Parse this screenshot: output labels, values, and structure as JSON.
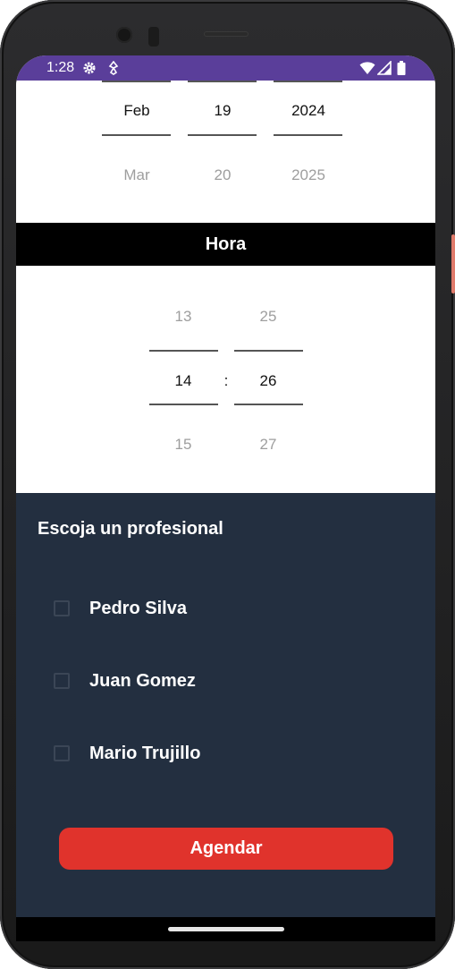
{
  "status_bar": {
    "time": "1:28",
    "bg_color": "#5a3e9a",
    "icons": [
      "settings-gear-icon",
      "accessibility-icon",
      "wifi-icon",
      "signal-icon",
      "battery-icon"
    ]
  },
  "date_picker": {
    "month": {
      "selected": "Feb",
      "next": "Mar"
    },
    "day": {
      "selected": "19",
      "next": "20"
    },
    "year": {
      "selected": "2024",
      "next": "2025"
    }
  },
  "time_section": {
    "title": "Hora",
    "hour": {
      "prev": "13",
      "selected": "14",
      "next": "15"
    },
    "separator": ":",
    "minute": {
      "prev": "25",
      "selected": "26",
      "next": "27"
    }
  },
  "professionals": {
    "title": "Escoja un profesional",
    "items": [
      {
        "name": "Pedro Silva",
        "checked": false
      },
      {
        "name": "Juan Gomez",
        "checked": false
      },
      {
        "name": "Mario Trujillo",
        "checked": false
      }
    ]
  },
  "actions": {
    "submit_label": "Agendar",
    "submit_color": "#e0332c"
  },
  "colors": {
    "panel_bg": "#232f40",
    "section_bar_bg": "#000000"
  }
}
